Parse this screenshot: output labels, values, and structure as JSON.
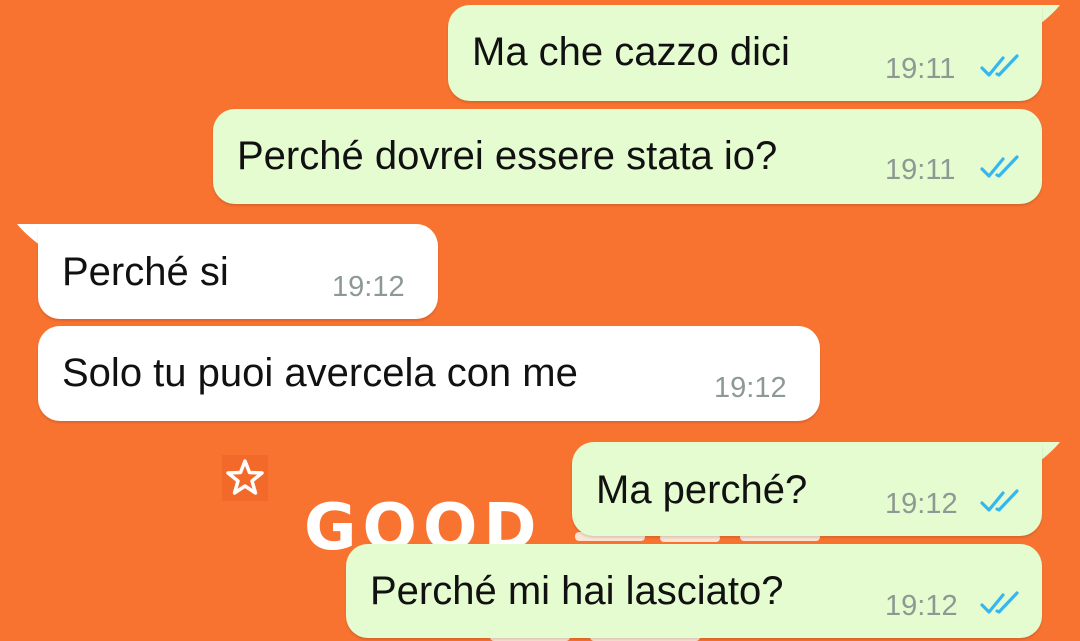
{
  "messages": [
    {
      "direction": "out",
      "text": "Ma che cazzo dici",
      "time": "19:11",
      "status": "read"
    },
    {
      "direction": "out",
      "text": "Perché dovrei essere stata io?",
      "time": "19:11",
      "status": "read"
    },
    {
      "direction": "in",
      "text": "Perché si",
      "time": "19:12"
    },
    {
      "direction": "in",
      "text": "Solo tu puoi avercela con me",
      "time": "19:12"
    },
    {
      "direction": "out",
      "text": "Ma perché?",
      "time": "19:12",
      "status": "read"
    },
    {
      "direction": "out",
      "text": "Perché mi hai lasciato?",
      "time": "19:12",
      "status": "read"
    }
  ],
  "wallpaper": {
    "text": "GOOD",
    "icon": "star-outline-icon",
    "background": "#F97330"
  },
  "colors": {
    "outgoing_bubble": "#E4FCCF",
    "incoming_bubble": "#FFFFFF",
    "read_ticks": "#34B7F1",
    "timestamp": "#8D9A93"
  }
}
